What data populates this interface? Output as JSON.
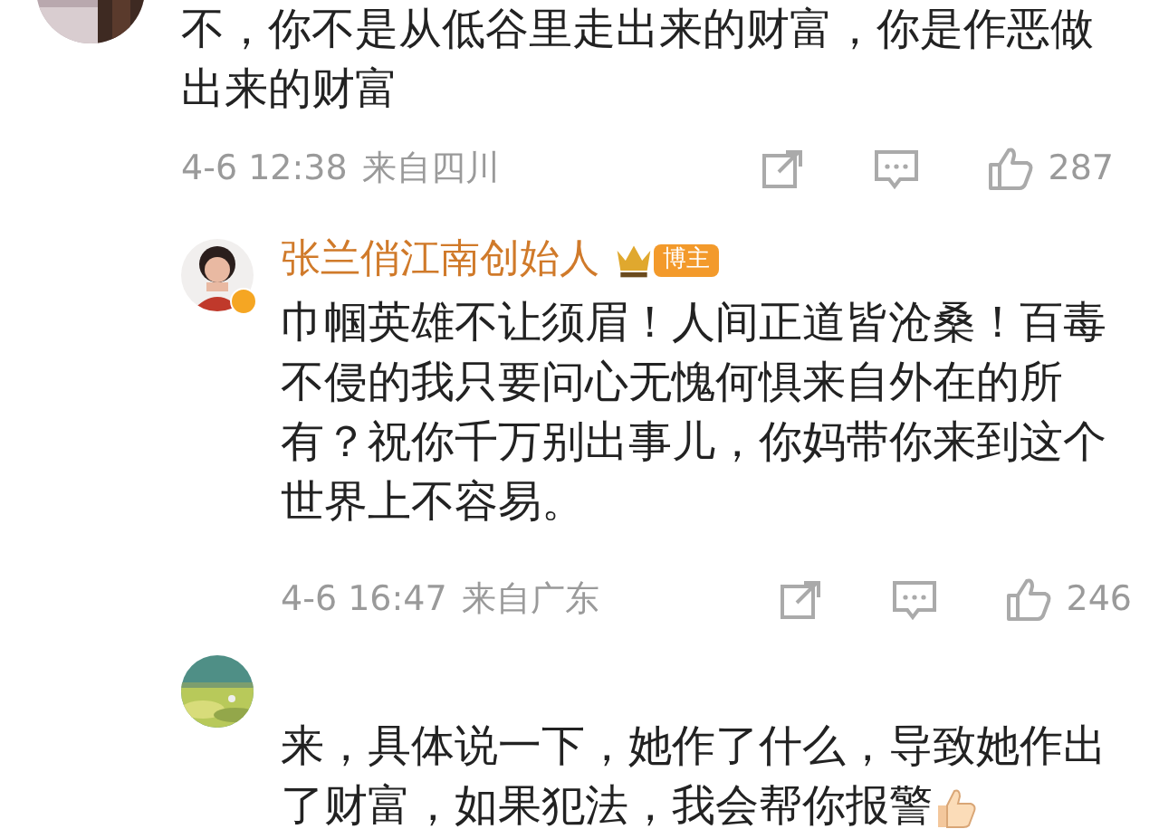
{
  "comments": [
    {
      "text": "不，你不是从低谷里走出来的财富，你是作恶做出来的财富",
      "time": "4-6 12:38",
      "location": "来自四川",
      "like_count": "287"
    },
    {
      "author": "张兰俏江南创始人",
      "verified": true,
      "badge": "博主",
      "text": "巾帼英雄不让须眉！人间正道皆沧桑！百毒不侵的我只要问心无愧何惧来自外在的所有？祝你千万别出事儿，你妈带你来到这个世界上不容易。",
      "time": "4-6 16:47",
      "location": "来自广东",
      "like_count": "246"
    },
    {
      "text": "来，具体说一下，她作了什么，导致她作出了财富，如果犯法，我会帮你报警",
      "trailing_emoji": true
    }
  ]
}
